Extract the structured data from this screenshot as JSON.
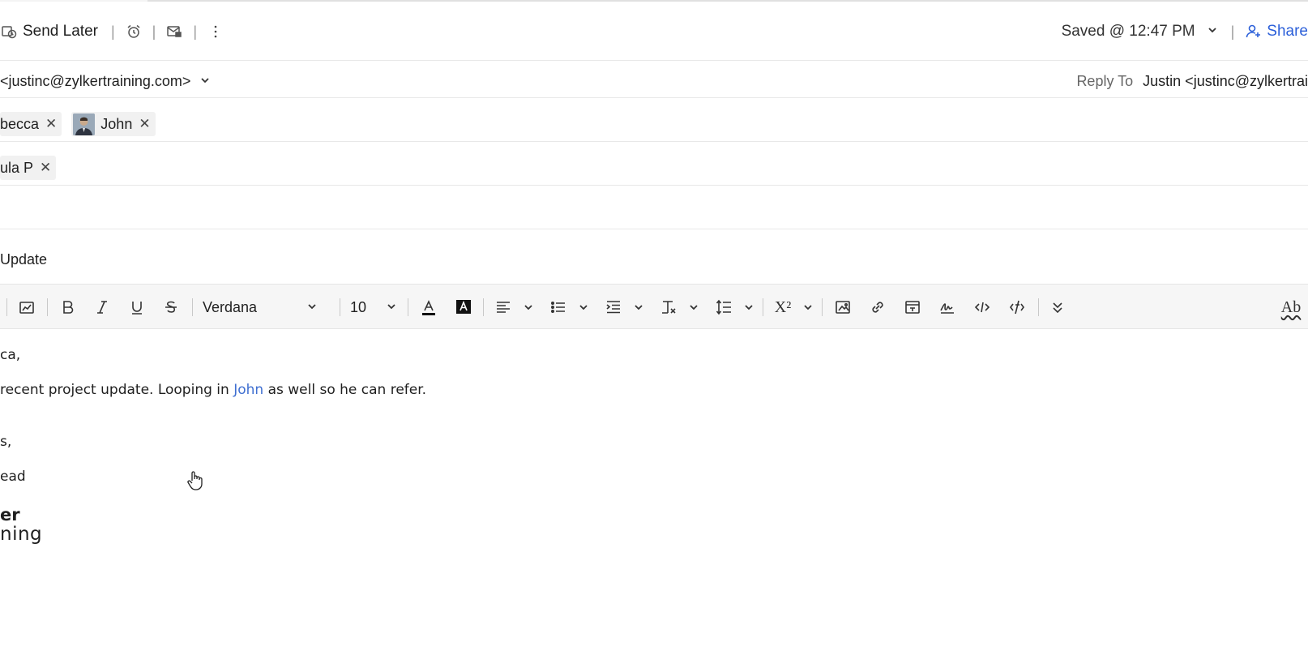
{
  "header": {
    "send_later": "Send Later",
    "saved_status": "Saved @ 12:47 PM",
    "share": "Share",
    "separator": "|"
  },
  "from": {
    "address": "<justinc@zylkertraining.com>",
    "reply_to_label": "Reply To",
    "reply_to_value": "Justin <justinc@zylkertrai"
  },
  "to": {
    "chips": [
      {
        "name": "becca"
      },
      {
        "name": "John"
      }
    ]
  },
  "cc": {
    "chips": [
      {
        "name": "ula P"
      }
    ]
  },
  "subject": {
    "value": "Update"
  },
  "editor_toolbar": {
    "font_family": "Verdana",
    "font_size": "10",
    "spellcheck_glyph": "Ab",
    "superscript_glyph": "X²"
  },
  "body": {
    "greeting": "ca,",
    "line1_before": "recent project update. Looping in ",
    "line1_mention": "John",
    "line1_after": " as well so he can refer.",
    "closing": "s,",
    "role": "ead",
    "sig_name": "er",
    "sig_company": "ning"
  }
}
